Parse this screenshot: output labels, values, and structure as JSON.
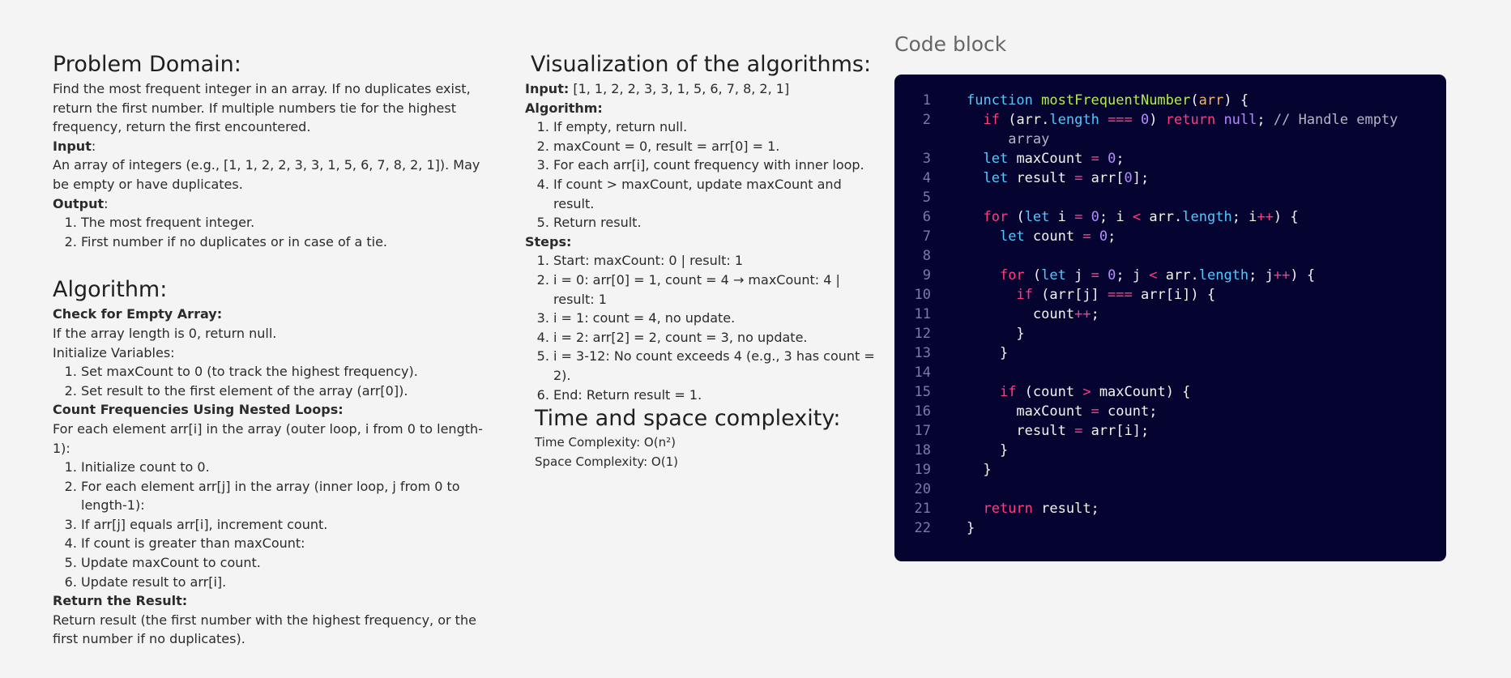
{
  "problem": {
    "title": "Problem Domain:",
    "description": "Find the most frequent integer in an array. If no duplicates exist, return the first number. If multiple numbers tie for the highest frequency, return the first encountered.",
    "input_label": "Input",
    "input_text": "An array of integers (e.g., [1, 1, 2, 2, 3, 3, 1, 5, 6, 7, 8, 2, 1]). May be empty or have duplicates.",
    "output_label": "Output",
    "outputs": [
      "The most frequent integer.",
      "First number if no duplicates or in case of a tie."
    ]
  },
  "algorithm": {
    "title": "Algorithm:",
    "check_label": "Check for Empty Array:",
    "check_text": "If the array length is 0, return null.",
    "init_text": "Initialize Variables:",
    "init_items": [
      "Set maxCount to 0 (to track the highest frequency).",
      "Set result to the first element of the array (arr[0])."
    ],
    "count_label": "Count Frequencies Using Nested Loops:",
    "count_text": "For each element arr[i] in the array (outer loop, i from 0 to length-1):",
    "count_items": [
      "Initialize count to 0.",
      "For each element arr[j] in the array (inner loop, j from 0 to length-1):",
      "If arr[j] equals arr[i], increment count.",
      "If count is greater than maxCount:",
      "Update maxCount to count.",
      "Update result to arr[i]."
    ],
    "return_label": "Return the Result:",
    "return_text": "Return result (the first number with the highest frequency, or the first number if no duplicates)."
  },
  "visualization": {
    "title": "Visualization of the algorithms:",
    "input_label": "Input:",
    "input_value": " [1, 1, 2, 2, 3, 3, 1, 5, 6, 7, 8, 2, 1]",
    "algorithm_label": "Algorithm:",
    "algorithm_items": [
      "If empty, return null.",
      "maxCount = 0, result = arr[0] = 1.",
      "For each arr[i], count frequency with inner loop.",
      "If count > maxCount, update maxCount and result.",
      "Return result."
    ],
    "steps_label": "Steps:",
    "steps_items": [
      "Start: maxCount: 0 | result: 1",
      "i = 0: arr[0] = 1, count = 4 → maxCount: 4 | result: 1",
      "i = 1: count = 4, no update.",
      "i = 2: arr[2] = 2, count = 3, no update.",
      "i = 3-12: No count exceeds 4 (e.g., 3 has count = 2).",
      "End: Return result = 1."
    ]
  },
  "complexity": {
    "title": "Time and space complexity:",
    "time": "Time Complexity: O(n²)",
    "space": "Space Complexity: O(1)"
  },
  "code": {
    "title": "Code block",
    "colors": {
      "background": "#05032f",
      "keyword": "#ff3d7f",
      "declaration": "#52c8ff",
      "function": "#b3ec4b",
      "number": "#b78bff"
    },
    "lines": [
      {
        "n": "1",
        "html": "<span class=\"dec\">function</span> <span class=\"fn\">mostFrequentNumber</span>(<span class=\"pm\">arr</span>) {"
      },
      {
        "n": "2",
        "html": "  <span class=\"kw\">if</span> (arr.<span class=\"pr\">length</span> <span class=\"op\">===</span> <span class=\"nm\">0</span>) <span class=\"kw\">return</span> <span class=\"nl\">null</span>; <span class=\"cm\">// Handle empty\n     array</span>"
      },
      {
        "n": "3",
        "html": "  <span class=\"dec\">let</span> maxCount <span class=\"op\">=</span> <span class=\"nm\">0</span>;"
      },
      {
        "n": "4",
        "html": "  <span class=\"dec\">let</span> result <span class=\"op\">=</span> arr[<span class=\"nm\">0</span>];"
      },
      {
        "n": "5",
        "html": ""
      },
      {
        "n": "6",
        "html": "  <span class=\"kw\">for</span> (<span class=\"dec\">let</span> i <span class=\"op\">=</span> <span class=\"nm\">0</span>; i <span class=\"op\">&lt;</span> arr.<span class=\"pr\">length</span>; i<span class=\"op\">++</span>) {"
      },
      {
        "n": "7",
        "html": "    <span class=\"dec\">let</span> count <span class=\"op\">=</span> <span class=\"nm\">0</span>;"
      },
      {
        "n": "8",
        "html": ""
      },
      {
        "n": "9",
        "html": "    <span class=\"kw\">for</span> (<span class=\"dec\">let</span> j <span class=\"op\">=</span> <span class=\"nm\">0</span>; j <span class=\"op\">&lt;</span> arr.<span class=\"pr\">length</span>; j<span class=\"op\">++</span>) {"
      },
      {
        "n": "10",
        "html": "      <span class=\"kw\">if</span> (arr[j] <span class=\"op\">===</span> arr[i]) {"
      },
      {
        "n": "11",
        "html": "        count<span class=\"op\">++</span>;"
      },
      {
        "n": "12",
        "html": "      }"
      },
      {
        "n": "13",
        "html": "    }"
      },
      {
        "n": "14",
        "html": ""
      },
      {
        "n": "15",
        "html": "    <span class=\"kw\">if</span> (count <span class=\"op\">&gt;</span> maxCount) {"
      },
      {
        "n": "16",
        "html": "      maxCount <span class=\"op\">=</span> count;"
      },
      {
        "n": "17",
        "html": "      result <span class=\"op\">=</span> arr[i];"
      },
      {
        "n": "18",
        "html": "    }"
      },
      {
        "n": "19",
        "html": "  }"
      },
      {
        "n": "20",
        "html": ""
      },
      {
        "n": "21",
        "html": "  <span class=\"kw\">return</span> result;"
      },
      {
        "n": "22",
        "html": "}"
      }
    ]
  }
}
